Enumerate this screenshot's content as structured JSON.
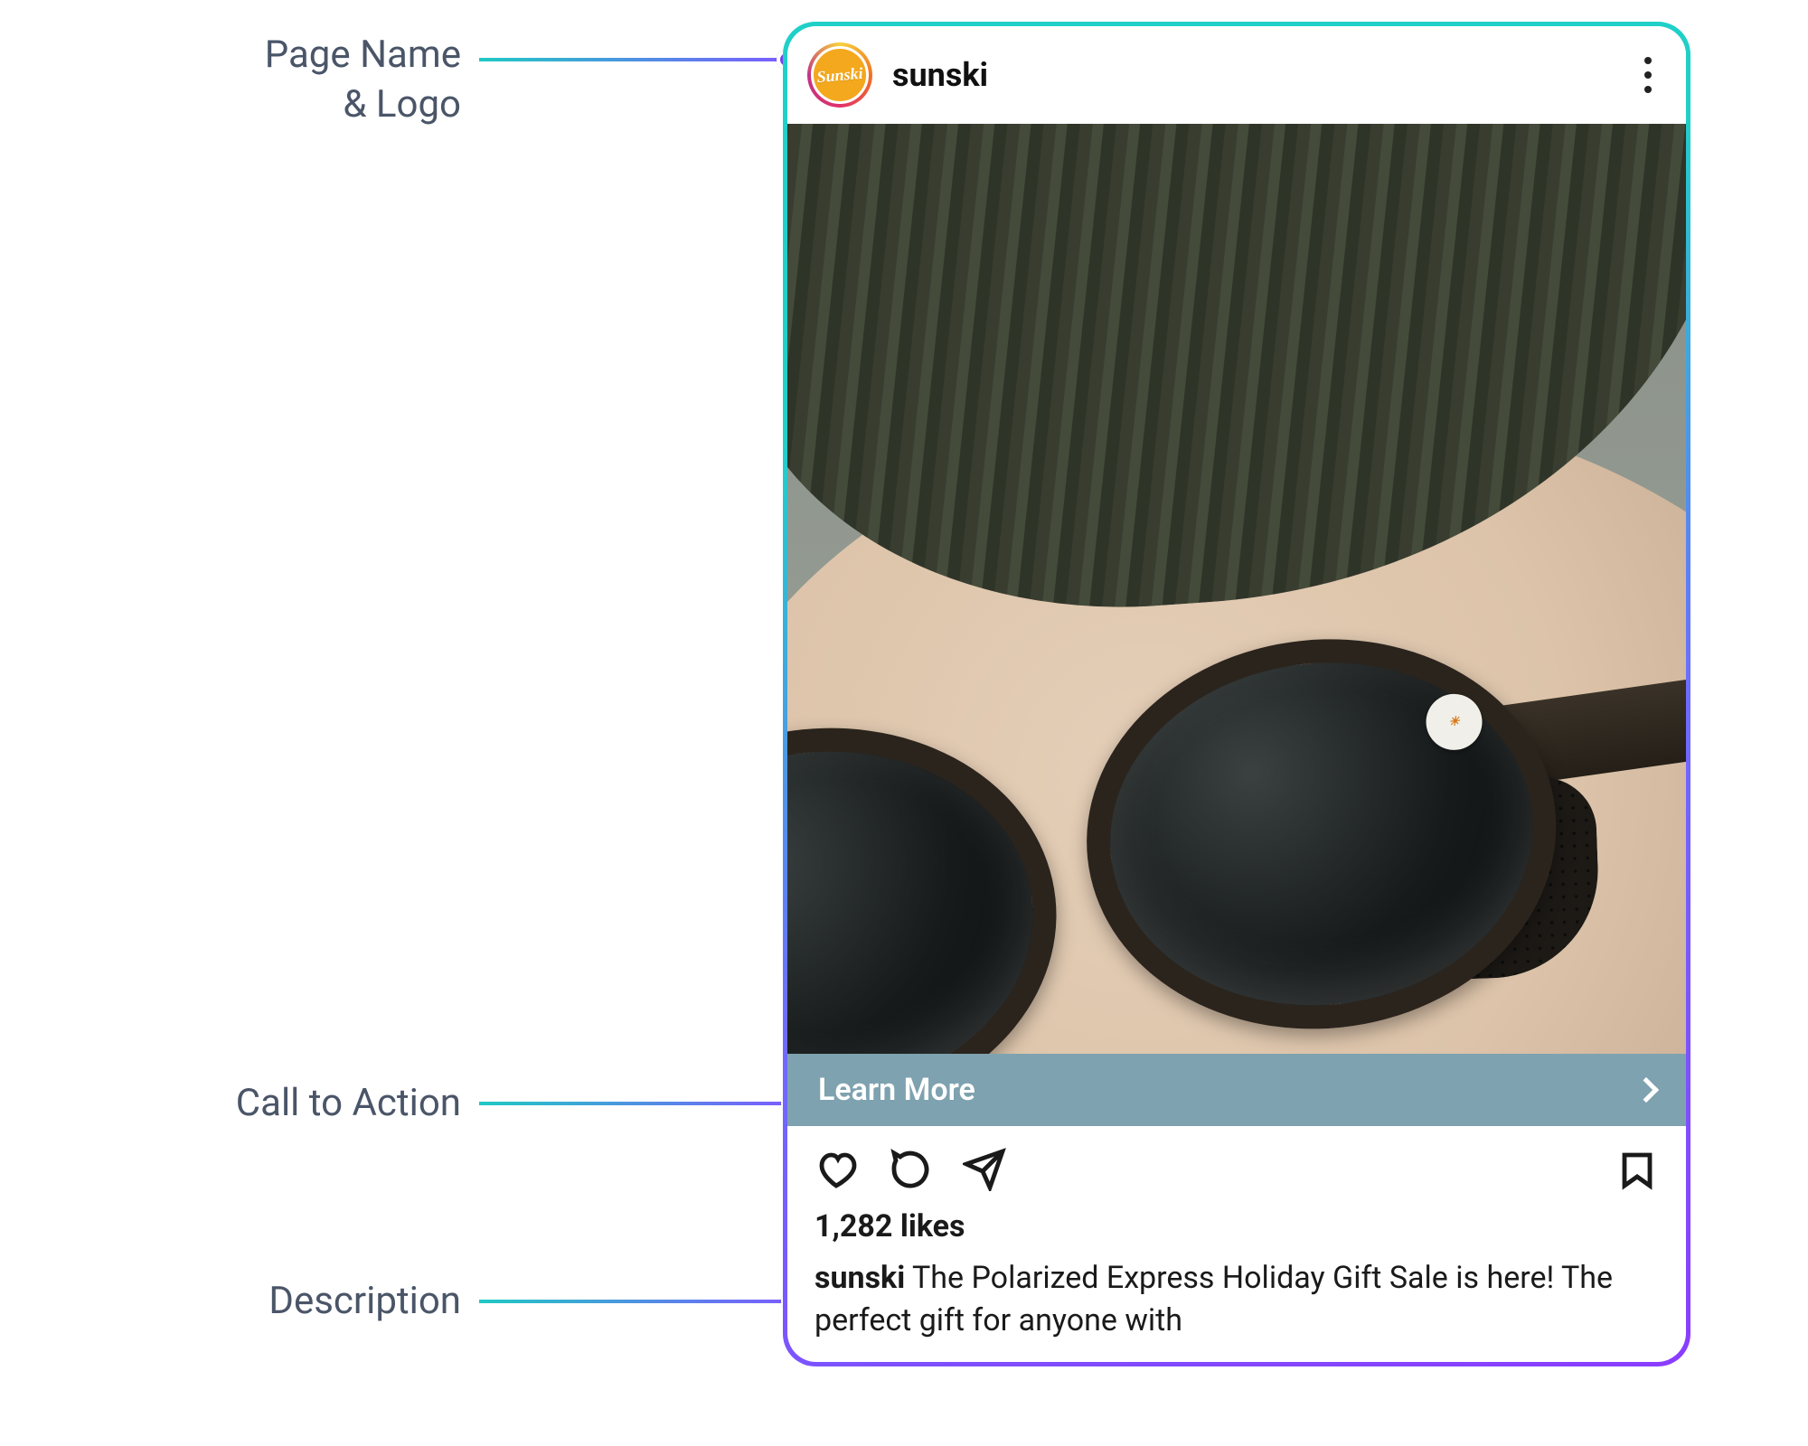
{
  "annotations": {
    "page_name_logo_line1": "Page Name",
    "page_name_logo_line2": "& Logo",
    "cta": "Call to Action",
    "description": "Description"
  },
  "post": {
    "page_name": "sunski",
    "avatar_text": "Sunski",
    "cta_label": "Learn More",
    "likes_text": "1,282 likes",
    "caption_author": "sunski",
    "caption_text": " The Polarized Express Holiday Gift Sale is here! The perfect gift for anyone with",
    "image_alt": "Close-up of a person wearing a dark green knit beanie and round black polarized Sunski sunglasses"
  },
  "colors": {
    "annotation_text": "#4a5568",
    "cta_bg": "#7ea2af",
    "gradient_start": "#20d0c8",
    "gradient_end": "#8a3cff",
    "dot": "#7b3ff2"
  }
}
